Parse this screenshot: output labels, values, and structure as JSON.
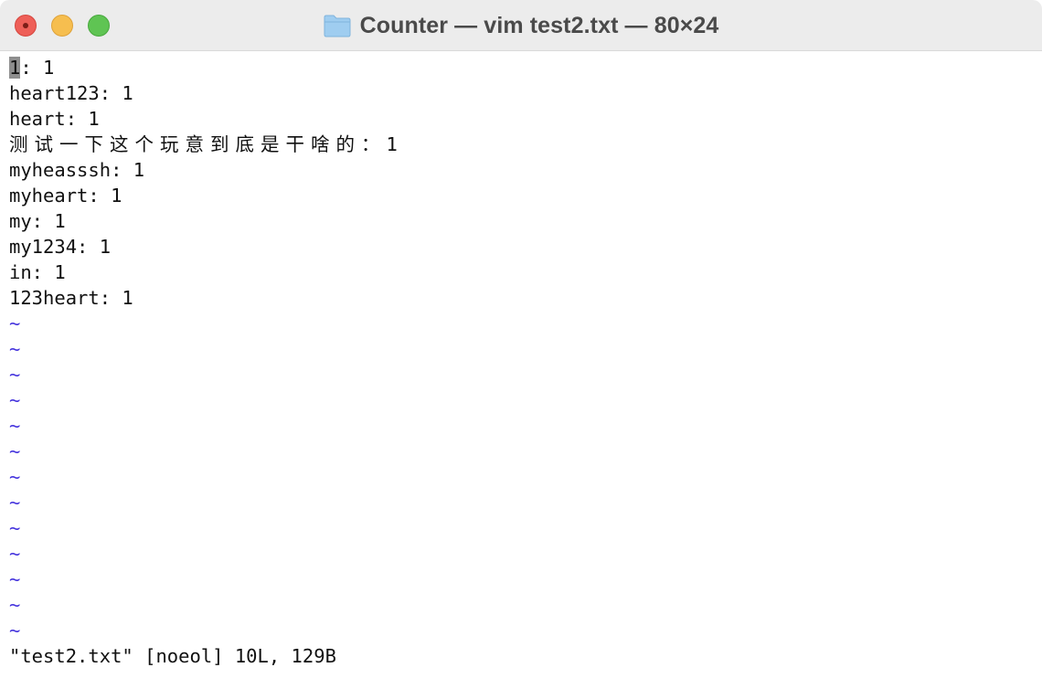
{
  "window": {
    "title": "Counter — vim test2.txt — 80×24"
  },
  "buffer": {
    "first_line_cursor_char": "1",
    "first_line_rest": ": 1",
    "lines": [
      "heart123: 1",
      "heart: 1",
      "测试一下这个玩意到底是干啥的：",
      "myheasssh: 1",
      "myheart: 1",
      "my: 1",
      "my1234: 1",
      "in: 1",
      "123heart: 1"
    ],
    "cjk_line_value": "1",
    "empty_marker": "~"
  },
  "status_line": "\"test2.txt\" [noeol] 10L, 129B",
  "colors": {
    "tilde": "#4433dd",
    "cursor": "#8e8e8e",
    "titlebar": "#ececec"
  }
}
